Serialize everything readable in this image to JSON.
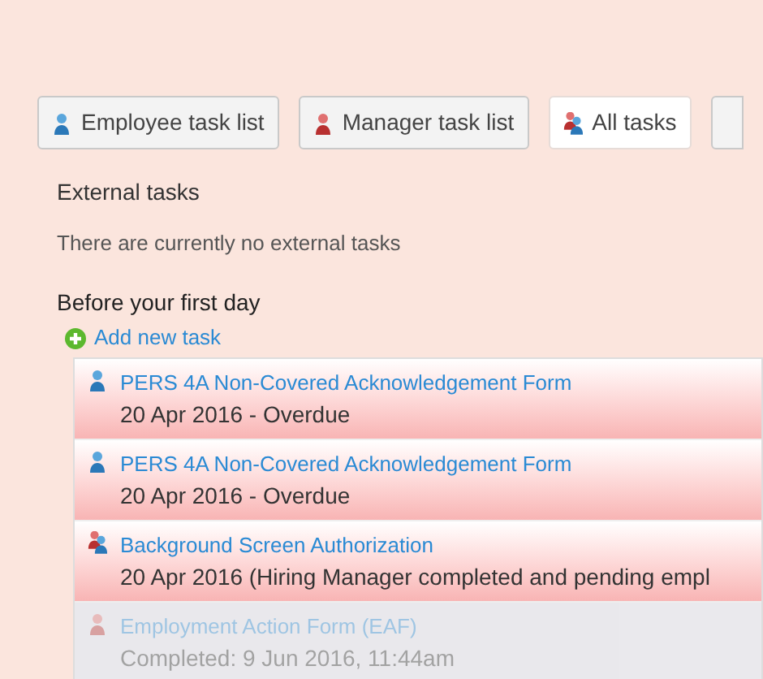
{
  "tabs": [
    {
      "label": "Employee task list",
      "kind": "employee",
      "selected": false
    },
    {
      "label": "Manager task list",
      "kind": "manager",
      "selected": false
    },
    {
      "label": "All tasks",
      "kind": "both",
      "selected": true
    }
  ],
  "external_tasks": {
    "heading": "External tasks",
    "message": "There are currently no external tasks"
  },
  "section": {
    "heading": "Before your first day",
    "add_link": "Add new task"
  },
  "tasks": [
    {
      "title": "PERS 4A Non-Covered Acknowledgement Form",
      "detail": "20 Apr 2016 - Overdue",
      "kind": "employee",
      "completed": false
    },
    {
      "title": "PERS 4A Non-Covered Acknowledgement Form",
      "detail": "20 Apr 2016 - Overdue",
      "kind": "employee",
      "completed": false
    },
    {
      "title": "Background Screen Authorization",
      "detail": "20 Apr 2016 (Hiring Manager completed and pending empl",
      "kind": "both",
      "completed": false
    },
    {
      "title": "Employment Action Form (EAF)",
      "detail": "Completed: 9 Jun 2016, 11:44am",
      "kind": "manager",
      "completed": true
    }
  ]
}
